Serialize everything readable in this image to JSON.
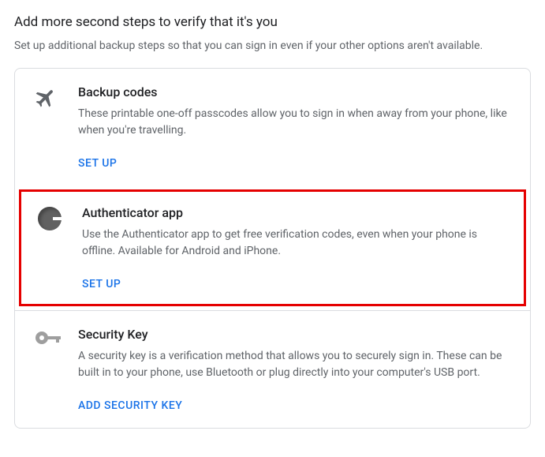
{
  "header": {
    "title": "Add more second steps to verify that it's you",
    "subtitle": "Set up additional backup steps so that you can sign in even if your other options aren't available."
  },
  "options": {
    "backup_codes": {
      "title": "Backup codes",
      "description": "These printable one-off passcodes allow you to sign in when away from your phone, like when you're travelling.",
      "action": "SET UP"
    },
    "authenticator": {
      "title": "Authenticator app",
      "description": "Use the Authenticator app to get free verification codes, even when your phone is offline. Available for Android and iPhone.",
      "action": "SET UP",
      "highlighted": true
    },
    "security_key": {
      "title": "Security Key",
      "description": "A security key is a verification method that allows you to securely sign in. These can be built in to your phone, use Bluetooth or plug directly into your computer's USB port.",
      "action": "ADD SECURITY KEY"
    }
  }
}
